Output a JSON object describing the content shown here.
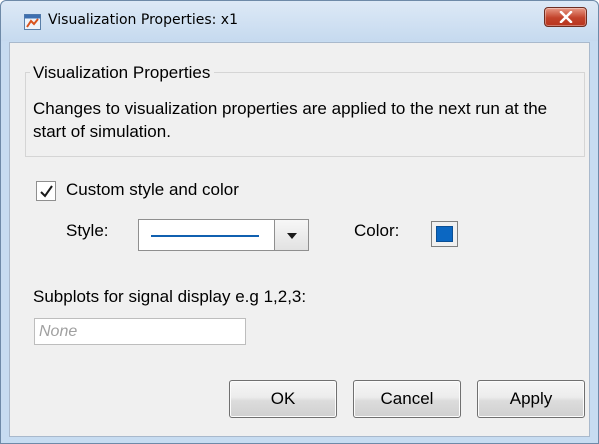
{
  "window": {
    "title": "Visualization Properties: x1",
    "icon": "matlab-window-icon",
    "close_icon": "close-icon",
    "accent_colors": {
      "close_button": "#c2432b",
      "line_color": "#0b67c2"
    }
  },
  "group": {
    "legend": "Visualization Properties",
    "description": "Changes to visualization properties are applied to the next run at the start of simulation."
  },
  "custom_style": {
    "checked": true,
    "label": "Custom style and color"
  },
  "style": {
    "label": "Style:",
    "selected": "solid line"
  },
  "color": {
    "label": "Color:",
    "value": "#0b67c2"
  },
  "subplots": {
    "label": "Subplots for signal display e.g 1,2,3:",
    "value": "",
    "placeholder": "None"
  },
  "buttons": {
    "ok": "OK",
    "cancel": "Cancel",
    "apply": "Apply"
  }
}
